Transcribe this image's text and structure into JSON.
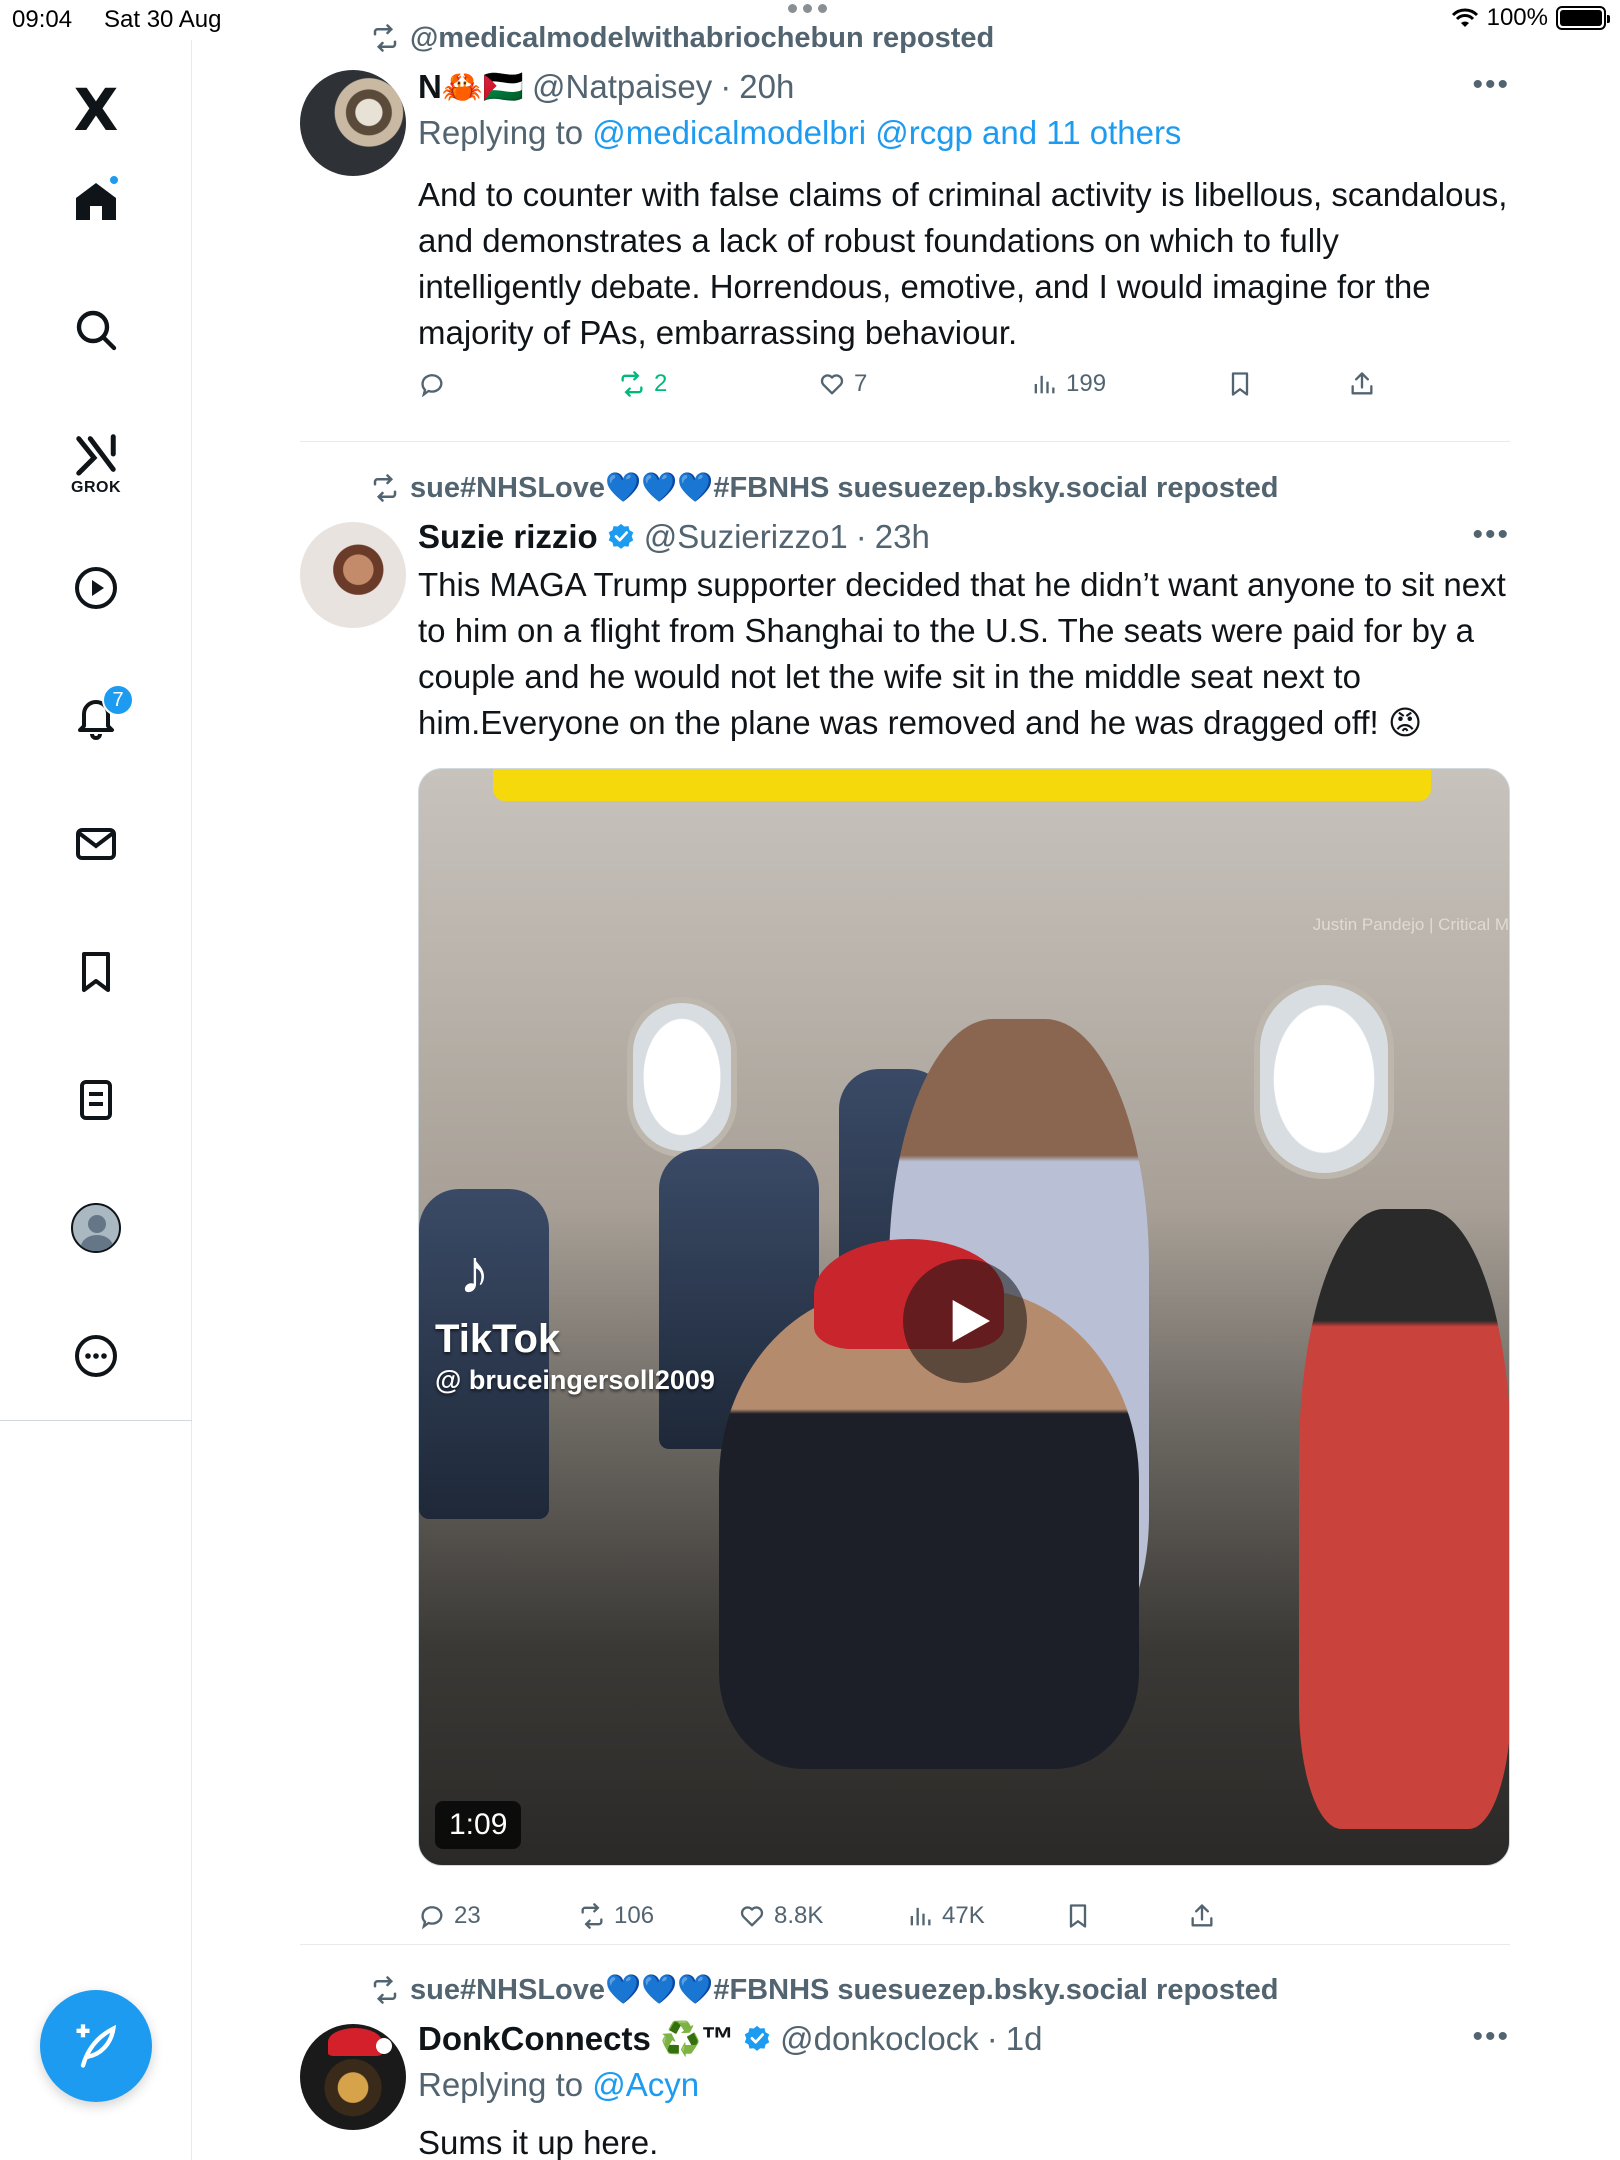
{
  "status_bar": {
    "time": "09:04",
    "date": "Sat 30 Aug",
    "battery": "100%",
    "battery_level": 1.0
  },
  "sidebar": {
    "logo": "X",
    "grok_label": "GROK",
    "notifications_count": "7",
    "items": [
      "home-icon",
      "search-icon",
      "grok-icon",
      "video-icon",
      "notifications-icon",
      "messages-icon",
      "bookmarks-icon",
      "lists-icon",
      "profile-icon",
      "more-icon"
    ]
  },
  "posts": [
    {
      "repost_by": "@medicalmodelwithabriochebun reposted",
      "author": "N🦀🇵🇸",
      "handle": "@Natpaisey",
      "time": "20h",
      "reply_prefix": "Replying to ",
      "reply_targets": "@medicalmodelbri @rcgp and 11 others",
      "text": "And to counter with false claims of criminal activity is libellous, scandalous, and demonstrates a lack of robust foundations on which to fully intelligently debate.  Horrendous, emotive, and I would imagine for the majority of PAs, embarrassing behaviour.",
      "replies": "",
      "reposts": "2",
      "likes": "7",
      "views": "199"
    },
    {
      "repost_by": "sue#NHSLove💙💙💙#FBNHS suesuezep.bsky.social reposted",
      "author": "Suzie rizzio",
      "handle": "@Suzierizzo1",
      "time": "23h",
      "text": "This MAGA Trump supporter decided that he didn’t want anyone to sit next to him on a flight from Shanghai to the U.S. The seats were paid for by a couple and he would not let the wife sit in the middle seat next to him.Everyone on the plane was removed and he was dragged off! 😡",
      "media": {
        "tiktok_name": "TikTok",
        "tiktok_handle": "@ bruceingersoll2009",
        "credit": "Justin Pandejo | Critical M",
        "duration": "1:09"
      },
      "replies": "23",
      "reposts": "106",
      "likes": "8.8K",
      "views": "47K"
    },
    {
      "repost_by": "sue#NHSLove💙💙💙#FBNHS suesuezep.bsky.social reposted",
      "author": "DonkConnects ♻️™",
      "handle": "@donkoclock",
      "time": "1d",
      "reply_prefix": "Replying to ",
      "reply_targets": "@Acyn",
      "text": "Sums it up here."
    }
  ],
  "colors": {
    "accent": "#1d9bf0",
    "repost_green": "#00ba7c",
    "secondary_text": "#536471"
  }
}
